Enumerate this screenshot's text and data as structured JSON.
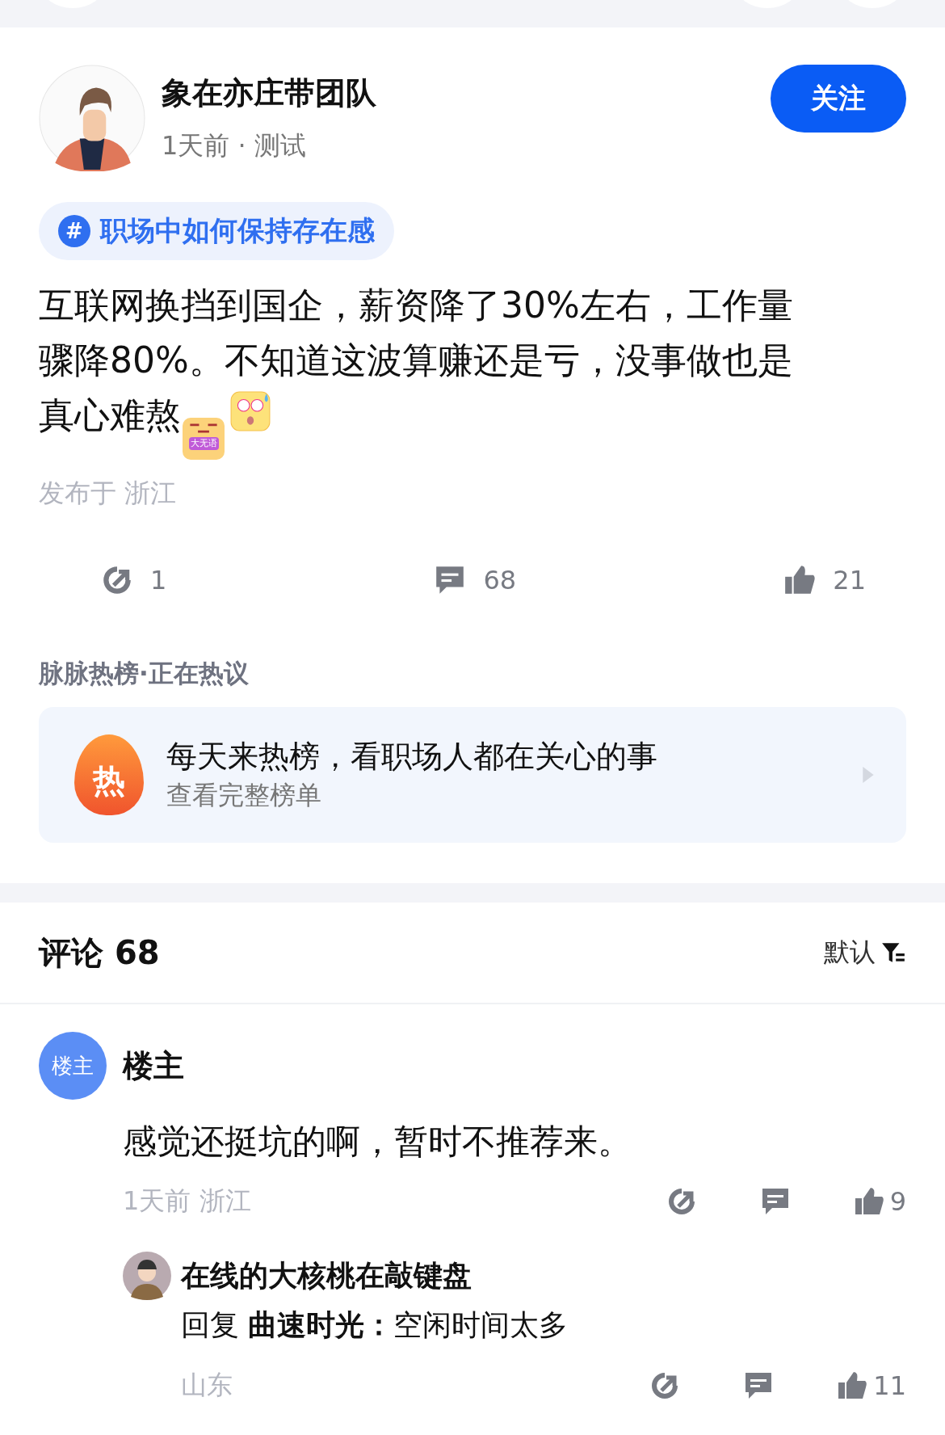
{
  "author": {
    "name": "象在亦庄带团队",
    "meta": "1天前 · 测试",
    "follow_label": "关注"
  },
  "topic": {
    "icon": "#",
    "label": "职场中如何保持存在感"
  },
  "post": {
    "text": "互联网换挡到国企，薪资降了30%左右，工作量骤降80%。不知道这波算赚还是亏，没事做也是真心难熬",
    "sticker_label": "大无语",
    "location": "发布于 浙江"
  },
  "actions": [
    {
      "kind": "share",
      "count": "1"
    },
    {
      "kind": "comment",
      "count": "68"
    },
    {
      "kind": "like",
      "count": "21"
    }
  ],
  "hot": {
    "section_title": "脉脉热榜·正在热议",
    "badge": "热",
    "title": "每天来热榜，看职场人都在关心的事",
    "subtitle": "查看完整榜单"
  },
  "comments_header": {
    "title": "评论 68",
    "sort_label": "默认"
  },
  "comments": [
    {
      "avatar_text": "楼主",
      "name": "楼主",
      "text": "感觉还挺坑的啊，暂时不推荐来。",
      "meta": "1天前  浙江",
      "actions": [
        {
          "kind": "share"
        },
        {
          "kind": "comment"
        },
        {
          "kind": "like",
          "count": "9"
        }
      ]
    }
  ],
  "replies": [
    {
      "name": "在线的大核桃在敲键盘",
      "reply_prefix": "回复",
      "reply_to": "曲速时光：",
      "text": "空闲时间太多",
      "meta": "山东",
      "actions": [
        {
          "kind": "share"
        },
        {
          "kind": "comment"
        },
        {
          "kind": "like",
          "count": "11"
        }
      ]
    }
  ]
}
